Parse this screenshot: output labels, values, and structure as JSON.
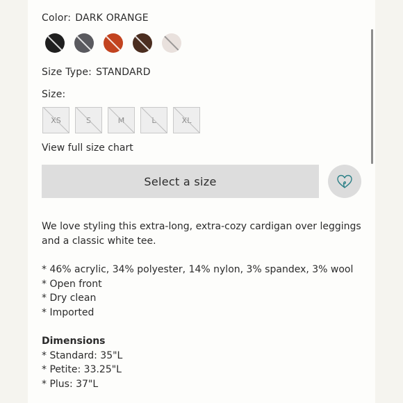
{
  "color": {
    "label": "Color:",
    "value": "DARK ORANGE"
  },
  "swatches": [
    {
      "name": "black",
      "color": "#1f1f1f"
    },
    {
      "name": "charcoal",
      "color": "#5a5a5f"
    },
    {
      "name": "dark-orange",
      "color": "#c2431f"
    },
    {
      "name": "brown",
      "color": "#4b2d1f"
    },
    {
      "name": "cream",
      "color": "#e9e1dd"
    }
  ],
  "size_type": {
    "label": "Size Type:",
    "value": "STANDARD"
  },
  "size": {
    "label": "Size:",
    "options": [
      "XS",
      "S",
      "M",
      "L",
      "XL"
    ]
  },
  "size_chart_link": "View full size chart",
  "select_button": "Select a size",
  "wishlist_icon": "heart-outline-icon",
  "accent_color": "#2a7f86",
  "description": {
    "intro_line1": "We love styling this extra-long, extra-cozy cardigan over leggings",
    "intro_line2": "and a classic white tee.",
    "bullets": [
      "* 46% acrylic, 34% polyester, 14% nylon, 3% spandex, 3% wool",
      "* Open front",
      "* Dry clean",
      "* Imported"
    ],
    "dimensions_title": "Dimensions",
    "dimensions": [
      "* Standard: 35\"L",
      "* Petite: 33.25\"L",
      "* Plus: 37\"L"
    ]
  }
}
